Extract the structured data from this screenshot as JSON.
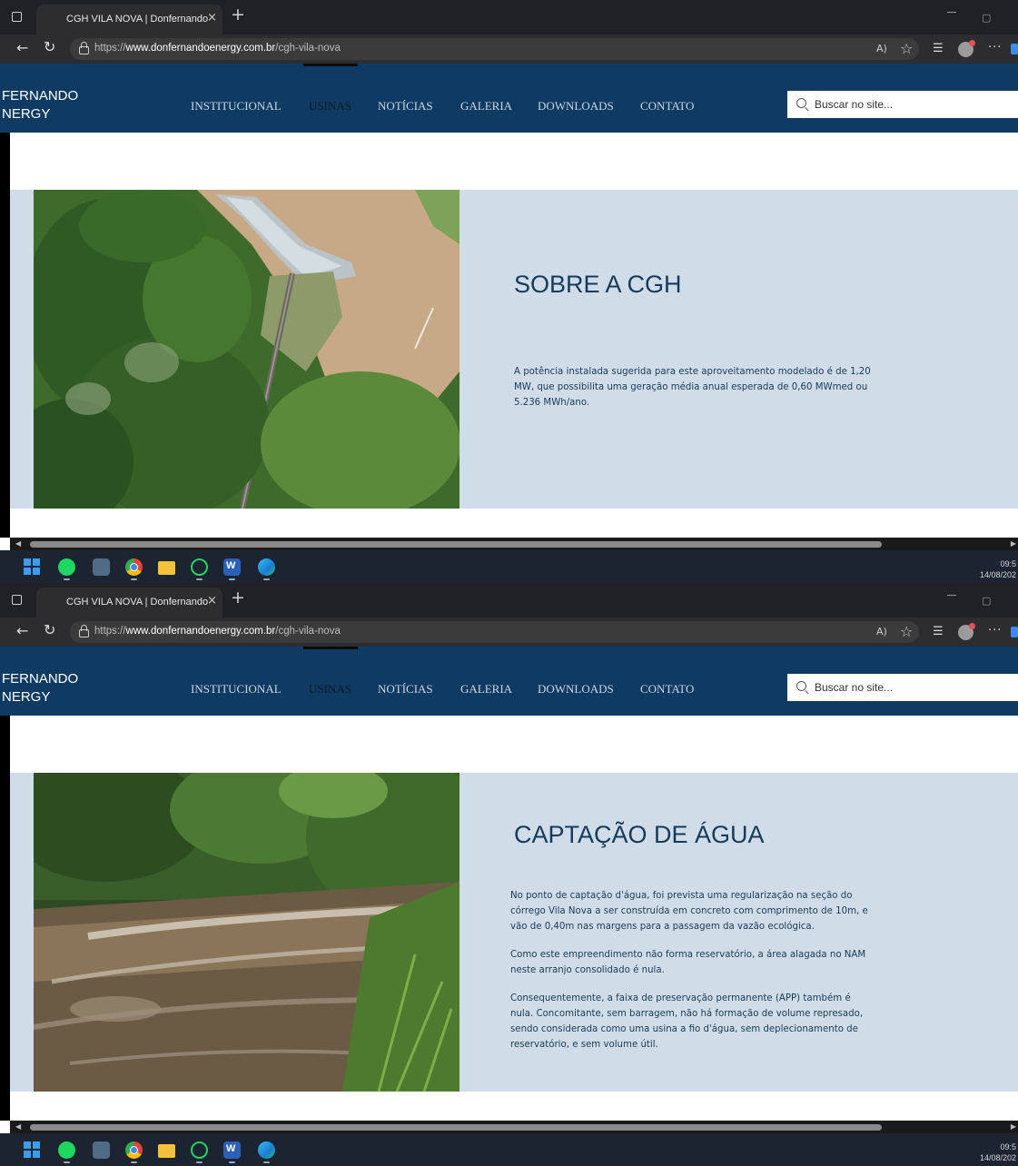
{
  "browser": {
    "tab_title": "CGH VILA NOVA | Donfernando",
    "tab_close": "×",
    "new_tab": "+",
    "url_prefix": "https://",
    "url_domain": "www.donfernandoenergy.com.br",
    "url_path": "/cgh-vila-nova",
    "read_aloud": "A)"
  },
  "site": {
    "logo_line1": "FERNANDO",
    "logo_line2": "NERGY",
    "menu": [
      "INSTITUCIONAL",
      "USINAS",
      "NOTÍCIAS",
      "GALERIA",
      "DOWNLOADS",
      "CONTATO"
    ],
    "active_menu": "USINAS",
    "search_placeholder": "Buscar no site..."
  },
  "screens": [
    {
      "photo": "aerial-dam-reservoir",
      "heading": "SOBRE A CGH",
      "paragraphs": [
        "A potência instalada sugerida para este aproveitamento modelado é de 1,20 MW, que possibilita uma geração média anual esperada de 0,60 MWmed ou 5.236 MWh/ano."
      ]
    },
    {
      "photo": "river-rapids-forest",
      "heading": "CAPTAÇÃO DE ÁGUA",
      "paragraphs": [
        "No ponto de captação d'água, foi prevista uma regularização na seção do córrego Vila Nova a ser construída em concreto com comprimento de 10m, e vão de 0,40m nas margens para a passagem da vazão ecológica.",
        "Como este empreendimento não forma reservatório, a área alagada no NAM neste arranjo consolidado é nula.",
        "Consequentemente, a faixa de preservação permanente (APP) também é nula. Concomitante, sem barragem, não há formação de volume represado, sendo considerada como uma usina a fio d'água, sem deplecionamento de reservatório, e sem volume útil."
      ]
    }
  ],
  "taskbar": {
    "apps": [
      "windows-start",
      "spotify",
      "calculator",
      "chrome",
      "file-explorer",
      "whatsapp",
      "word",
      "edge"
    ],
    "time": "09:5",
    "date": "14/08/202"
  },
  "colors": {
    "header": "#0f3b62",
    "band": "#d0dde8",
    "heading": "#153a5c"
  }
}
